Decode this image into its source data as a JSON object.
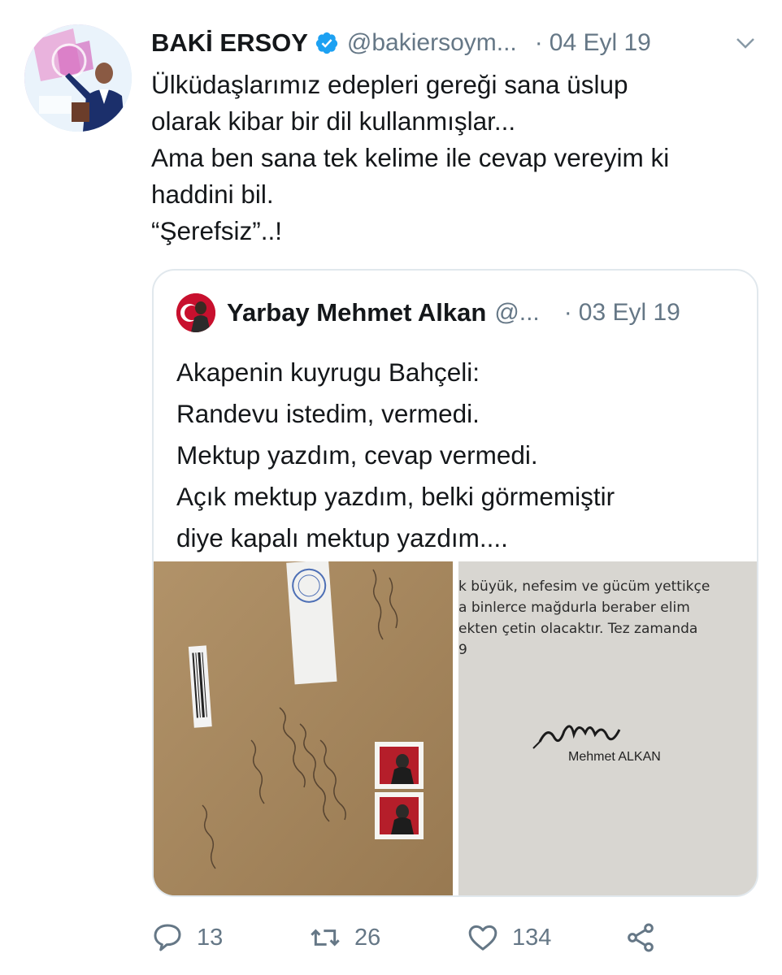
{
  "tweet": {
    "author_name": "BAKİ ERSOY",
    "author_handle": "@bakiersoym...",
    "separator": "·",
    "date": "04 Eyl 19",
    "text_lines": [
      "Ülküdaşlarımız edepleri gereği sana üslup",
      "olarak kibar bir dil kullanmışlar...",
      "Ama ben sana tek kelime ile cevap vereyim ki",
      "haddini bil.",
      "“Şerefsiz”..!"
    ],
    "icons": {
      "verified": "verified-badge-icon",
      "more": "chevron-down-icon"
    }
  },
  "quoted_tweet": {
    "author_name": "Yarbay Mehmet Alkan",
    "author_handle": "@...",
    "separator": "·",
    "date": "03 Eyl 19",
    "text_lines": [
      "Akapenin kuyrugu Bahçeli:",
      "Randevu istedim, vermedi.",
      "Mektup yazdım, cevap vermedi.",
      "Açık mektup yazdım, belki görmemiştir",
      "diye kapalı mektup yazdım...."
    ],
    "media": {
      "letter_lines": [
        "k büyük, nefesim ve gücüm yettikçe",
        "a  binlerce  mağdurla  beraber  elim",
        "ekten çetin olacaktır. Tez zamanda",
        "9"
      ],
      "signer": "Mehmet ALKAN"
    }
  },
  "actions": {
    "reply_count": "13",
    "retweet_count": "26",
    "like_count": "134"
  },
  "colors": {
    "text": "#14171a",
    "secondary": "#657786",
    "verified": "#1da1f2",
    "border": "#e1e8ed"
  }
}
